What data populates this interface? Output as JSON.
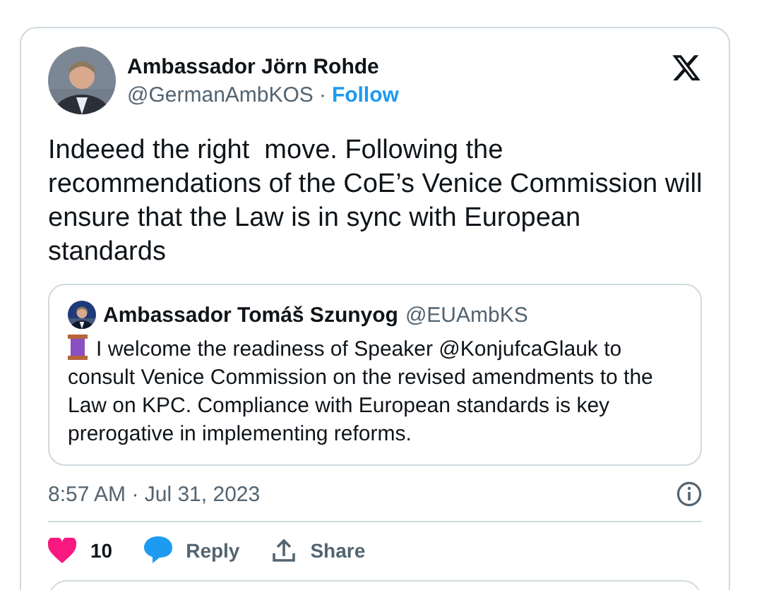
{
  "author": {
    "name": "Ambassador Jörn Rohde",
    "handle": "@GermanAmbKOS",
    "separator": "·",
    "follow": "Follow"
  },
  "text": "Indeeed the right  move. Following the recommendations of the CoE’s Venice Commission will ensure that the Law is in sync with European standards",
  "quote": {
    "name": "Ambassador Tomáš Szunyog",
    "handle": "@EUAmbKS",
    "text": "I welcome the readiness of Speaker @KonjufcaGlauk to consult Venice Commission on the revised amendments to the Law on KPC. Compliance with European standards is key prerogative in implementing reforms."
  },
  "timestamp": "8:57 AM · Jul 31, 2023",
  "actions": [
    {
      "kind": "like",
      "label": "10"
    },
    {
      "kind": "reply",
      "label": "Reply"
    },
    {
      "kind": "share",
      "label": "Share"
    }
  ]
}
